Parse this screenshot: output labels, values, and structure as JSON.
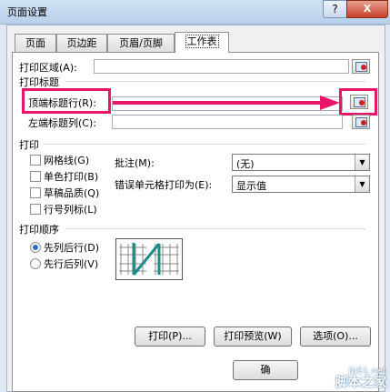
{
  "window": {
    "title": "页面设置",
    "help": "?",
    "close": "X"
  },
  "tabs": [
    {
      "label": "页面"
    },
    {
      "label": "页边距"
    },
    {
      "label": "页眉/页脚"
    },
    {
      "label": "工作表",
      "active": true
    }
  ],
  "print_area": {
    "label": "打印区域(A):",
    "value": ""
  },
  "print_titles": {
    "group": "打印标题",
    "top_rows": {
      "label": "顶端标题行(R):",
      "value": ""
    },
    "left_cols": {
      "label": "左端标题列(C):",
      "value": ""
    }
  },
  "print": {
    "group": "打印",
    "checkboxes": [
      {
        "label": "网格线(G)",
        "checked": false
      },
      {
        "label": "单色打印(B)",
        "checked": false
      },
      {
        "label": "草稿品质(Q)",
        "checked": false
      },
      {
        "label": "行号列标(L)",
        "checked": false
      }
    ],
    "comments": {
      "label": "批注(M):",
      "value": "(无)"
    },
    "errors": {
      "label": "错误单元格打印为(E):",
      "value": "显示值"
    }
  },
  "page_order": {
    "group": "打印顺序",
    "options": [
      {
        "label": "先列后行(D)",
        "selected": true
      },
      {
        "label": "先行后列(V)",
        "selected": false
      }
    ]
  },
  "buttons": {
    "print": "打印(P)...",
    "preview": "打印预览(W)",
    "options": "选项(O)...",
    "ok": "确"
  },
  "watermark": {
    "line1": "jb51.net",
    "line2": "脚本之家"
  },
  "annotation_color": "#e8156b"
}
